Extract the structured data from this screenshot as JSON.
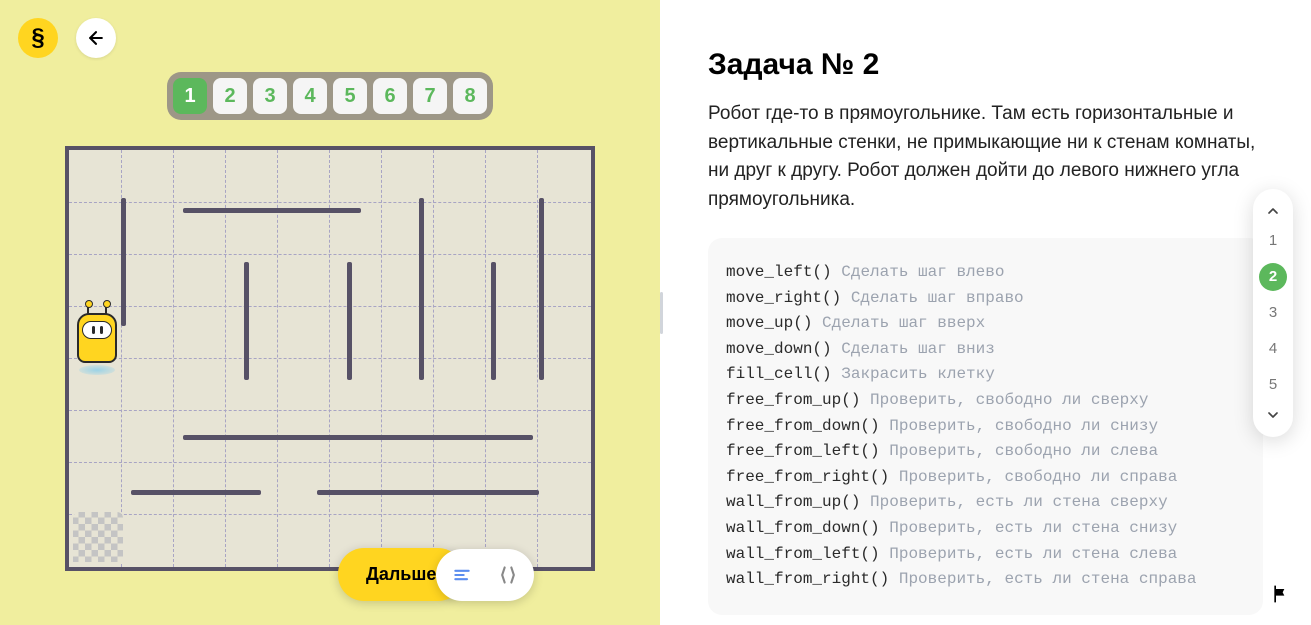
{
  "header": {
    "logo_char": "§"
  },
  "tabs": {
    "items": [
      "1",
      "2",
      "3",
      "4",
      "5",
      "6",
      "7",
      "8"
    ],
    "active_index": 0
  },
  "next_button": "Дальше",
  "task": {
    "title": "Задача № 2",
    "description": "Робот где-то в прямоугольнике. Там есть горизонтальные и вертикальные стенки, не примыкающие ни к стенам комнаты, ни друг к другу. Робот должен дойти до левого нижнего угла прямоугольника."
  },
  "commands": [
    {
      "cmd": "move_left()",
      "desc": "Сделать шаг влево"
    },
    {
      "cmd": "move_right()",
      "desc": "Сделать шаг вправо"
    },
    {
      "cmd": "move_up()",
      "desc": "Сделать шаг вверх"
    },
    {
      "cmd": "move_down()",
      "desc": "Сделать шаг вниз"
    },
    {
      "cmd": "fill_cell()",
      "desc": "Закрасить клетку"
    },
    {
      "cmd": "free_from_up()",
      "desc": "Проверить, свободно ли сверху"
    },
    {
      "cmd": "free_from_down()",
      "desc": "Проверить, свободно ли снизу"
    },
    {
      "cmd": "free_from_left()",
      "desc": "Проверить, свободно ли слева"
    },
    {
      "cmd": "free_from_right()",
      "desc": "Проверить, свободно ли справа"
    },
    {
      "cmd": "wall_from_up()",
      "desc": "Проверить, есть ли стена сверху"
    },
    {
      "cmd": "wall_from_down()",
      "desc": "Проверить, есть ли стена снизу"
    },
    {
      "cmd": "wall_from_left()",
      "desc": "Проверить, есть ли стена слева"
    },
    {
      "cmd": "wall_from_right()",
      "desc": "Проверить, есть ли стена справа"
    }
  ],
  "side_nav": {
    "items": [
      "1",
      "2",
      "3",
      "4",
      "5"
    ],
    "active_index": 1
  }
}
